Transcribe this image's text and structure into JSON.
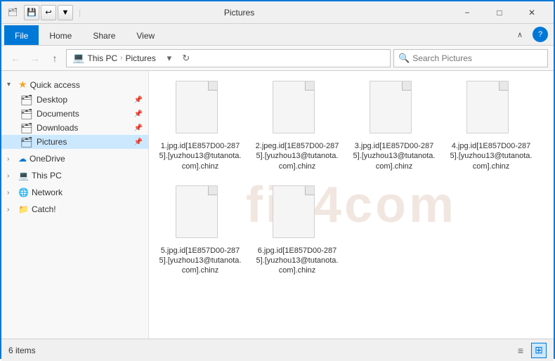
{
  "titleBar": {
    "title": "Pictures",
    "quickSave": "💾",
    "undo": "↩",
    "dropdownIcon": "▼"
  },
  "ribbon": {
    "tabs": [
      "File",
      "Home",
      "Share",
      "View"
    ],
    "activeTab": "File",
    "collapseLabel": "∧",
    "helpLabel": "?"
  },
  "addressBar": {
    "back": "←",
    "forward": "→",
    "up": "↑",
    "thisPc": "This PC",
    "pictures": "Pictures",
    "searchPlaceholder": "Search Pictures",
    "refreshIcon": "↻",
    "dropdownIcon": "▾",
    "searchIcon": "🔍"
  },
  "sidebar": {
    "quickAccess": {
      "label": "Quick access",
      "items": [
        {
          "label": "Desktop",
          "pinned": true
        },
        {
          "label": "Documents",
          "pinned": true
        },
        {
          "label": "Downloads",
          "pinned": true
        },
        {
          "label": "Pictures",
          "pinned": true,
          "selected": true
        }
      ]
    },
    "oneDrive": {
      "label": "OneDrive"
    },
    "thisPC": {
      "label": "This PC"
    },
    "network": {
      "label": "Network"
    },
    "catch": {
      "label": "Catch!"
    }
  },
  "files": [
    {
      "name": "1.jpg.id[1E857D00-2875].[yuzhou13@tutanota.com].chinz"
    },
    {
      "name": "2.jpeg.id[1E857D00-2875].[yuzhou13@tutanota.com].chinz"
    },
    {
      "name": "3.jpg.id[1E857D00-2875].[yuzhou13@tutanota.com].chinz"
    },
    {
      "name": "4.jpg.id[1E857D00-2875].[yuzhou13@tutanota.com].chinz"
    },
    {
      "name": "5.jpg.id[1E857D00-2875].[yuzhou13@tutanota.com].chinz"
    },
    {
      "name": "6.jpg.id[1E857D00-2875].[yuzhou13@tutanota.com].chinz"
    }
  ],
  "statusBar": {
    "itemCount": "6 items",
    "viewList": "≡",
    "viewDetails": "⊞"
  },
  "watermark": "fix4com"
}
